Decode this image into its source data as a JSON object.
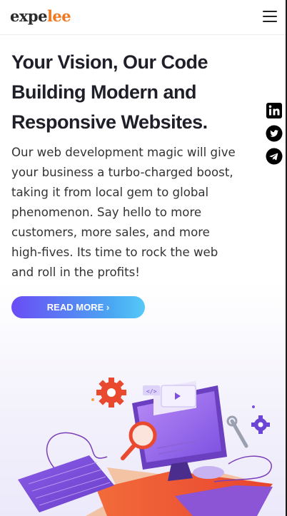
{
  "brand": {
    "logo_part1": "expe",
    "logo_part2": "lee"
  },
  "hero": {
    "headline_lines": [
      "Your Vision, Our Code",
      "Building Modern and",
      "Responsive Websites."
    ],
    "description_lines": [
      "Our web development magic will give",
      "your business a turbo-charged boost,",
      "taking it from local gem to global",
      "phenomenon. Say hello to more",
      "customers, more sales, and more",
      "high-fives. Its time to rock the web",
      "and roll in the profits!"
    ],
    "cta_label": "READ MORE ›"
  },
  "social": {
    "icons": [
      "linkedin-icon",
      "twitter-icon",
      "telegram-icon"
    ]
  },
  "colors": {
    "brand_orange": "#f07a22",
    "button_gradient_start": "#6a4cf5",
    "button_gradient_end": "#56c9f7"
  }
}
